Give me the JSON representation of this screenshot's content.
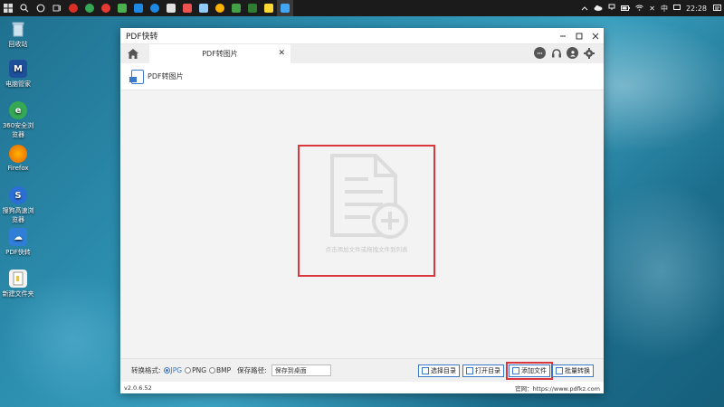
{
  "taskbar": {
    "clock": "22:28",
    "ime": "中",
    "tray_x": "✕"
  },
  "desktop": {
    "icons": [
      {
        "label": "回收站",
        "color": "#9fb8c9",
        "glyph": "🗑"
      },
      {
        "label": "电脑管家",
        "color": "#1d4f9a",
        "glyph": "M"
      },
      {
        "label": "360安全浏览器",
        "color": "#34a853",
        "glyph": "e"
      },
      {
        "label": "Firefox",
        "color": "#e66000",
        "glyph": "●"
      },
      {
        "label": "搜狗高速浏览器",
        "color": "#2a6fd6",
        "glyph": "S"
      },
      {
        "label": "PDF快转",
        "color": "#2f7fd8",
        "glyph": "☁"
      },
      {
        "label": "新建文件夹",
        "color": "#e7c05a",
        "glyph": "▌"
      }
    ]
  },
  "window": {
    "title": "PDF快转",
    "tab_label": "PDF转图片",
    "tab_close": "✕",
    "sub_title": "PDF转图片",
    "drop_hint": "点击添加文件或拖拽文件到列表",
    "format_label": "转换格式:",
    "formats": [
      "JPG",
      "PNG",
      "BMP"
    ],
    "selected_format": "JPG",
    "save_label": "保存路径:",
    "save_value": "保存到桌面",
    "buttons": {
      "choose_dir": "选择目录",
      "open_dir": "打开目录",
      "add_file": "添加文件",
      "batch_convert": "批量转换"
    },
    "version": "v2.0.6.52",
    "website": "官网：https://www.pdfkz.com"
  },
  "colors": {
    "accent": "#3a78c9",
    "highlight": "#d9363e"
  }
}
